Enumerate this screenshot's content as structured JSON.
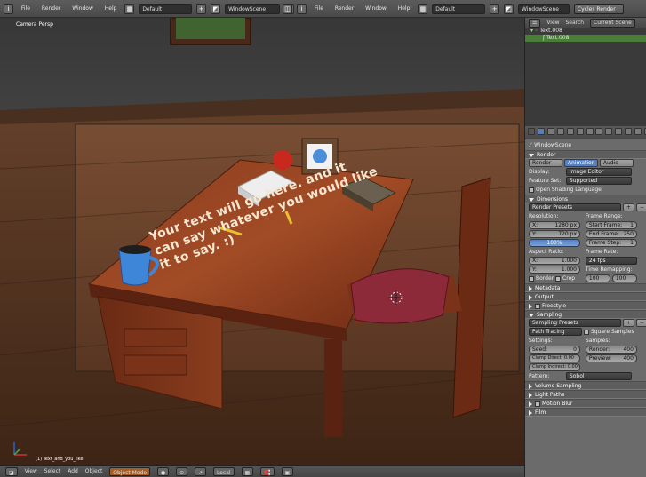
{
  "top_bar": {
    "left_menus": [
      "File",
      "Render",
      "Window",
      "Help"
    ],
    "left_layout": "Default",
    "left_scene": "WindowScene",
    "right_menus": [
      "File",
      "Render",
      "Window",
      "Help"
    ],
    "right_layout": "Default",
    "right_scene": "WindowScene",
    "engine": "Cycles Render"
  },
  "viewport": {
    "label": "Camera Persp",
    "overlay_text": "Your text will go here. and it can say whatever you would like it to say. :)",
    "object_info": "(1) Text_and_you_like"
  },
  "viewport_header": {
    "menus": [
      "View",
      "Select",
      "Add",
      "Object"
    ],
    "mode": "Object Mode",
    "pivot": "Local"
  },
  "outliner": {
    "menus": [
      "View",
      "Search"
    ],
    "filter": "Current Scene",
    "items": [
      "Text.008",
      "Text.008"
    ]
  },
  "properties": {
    "context": "WindowScene",
    "render_section": "Render",
    "render_buttons": [
      "Render",
      "Animation",
      "Audio"
    ],
    "display_label": "Display:",
    "display_value": "Image Editor",
    "feature_label": "Feature Set:",
    "feature_value": "Supported",
    "osl_label": "Open Shading Language",
    "dimensions_section": "Dimensions",
    "render_presets": "Render Presets",
    "resolution_label": "Resolution:",
    "res_x": "X:",
    "res_x_val": "1280 px",
    "res_y": "Y:",
    "res_y_val": "720 px",
    "res_pct": "100%",
    "frame_range_label": "Frame Range:",
    "start_frame": "Start Frame:",
    "start_val": "1",
    "end_frame": "End Frame:",
    "end_val": "250",
    "frame_step": "Frame Step:",
    "step_val": "1",
    "aspect_label": "Aspect Ratio:",
    "asp_x": "X:",
    "asp_x_val": "1.000",
    "asp_y": "Y:",
    "asp_y_val": "1.000",
    "frame_rate_label": "Frame Rate:",
    "fps": "24 fps",
    "time_remap": "Time Remapping:",
    "remap_old": "100",
    "remap_new": "100",
    "border": "Border",
    "crop": "Crop",
    "sections_collapsed": [
      "Metadata",
      "Output",
      "Freestyle"
    ],
    "sampling_section": "Sampling",
    "sampling_presets": "Sampling Presets",
    "path_tracing": "Path Tracing",
    "square_samples": "Square Samples",
    "settings_label": "Settings:",
    "samples_label": "Samples:",
    "seed": "Seed:",
    "seed_val": "0",
    "clamp_direct": "Clamp Direct: 0.00",
    "clamp_indirect": "Clamp Indirect: 0.00",
    "render_samples": "Render:",
    "render_samples_val": "400",
    "preview_samples": "Preview:",
    "preview_samples_val": "400",
    "pattern_label": "Pattern:",
    "pattern_val": "Sobol",
    "more_sections": [
      "Volume Sampling",
      "Light Paths",
      "Motion Blur",
      "Film"
    ]
  },
  "colors": {
    "outliner_highlight": "#4a7d3a",
    "render_btn_active": "#5680c2"
  }
}
